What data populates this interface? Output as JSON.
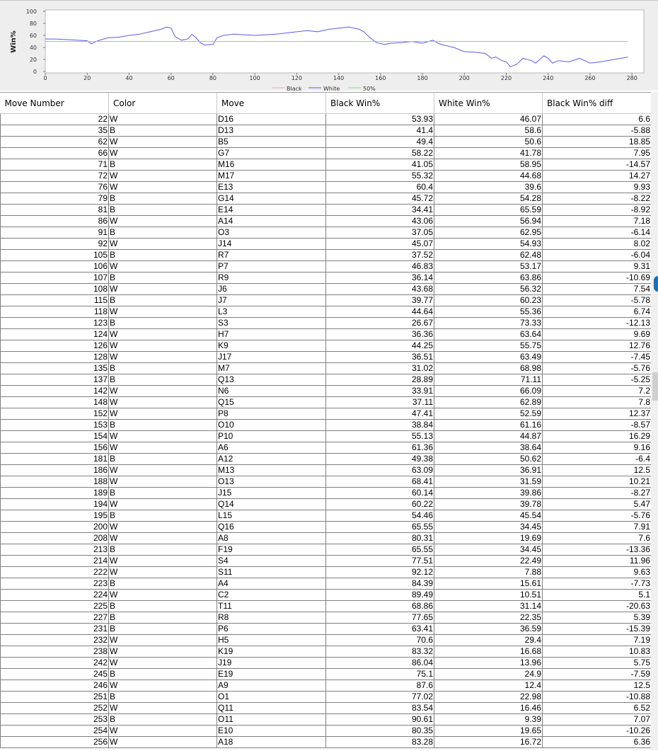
{
  "chart": {
    "ylabel": "Win%",
    "y_ticks": [
      "0",
      "20",
      "40",
      "60",
      "80",
      "100"
    ],
    "x_ticks": [
      "0",
      "20",
      "40",
      "60",
      "80",
      "100",
      "120",
      "140",
      "160",
      "180",
      "200",
      "220",
      "240",
      "260",
      "280"
    ],
    "legend": [
      "Black",
      "White",
      "50%"
    ],
    "colors": {
      "black": "#f4a6a6",
      "white": "#5b5bf0",
      "fifty": "#7ee07e"
    }
  },
  "chart_data": {
    "type": "line",
    "title": "",
    "xlabel": "",
    "ylabel": "Win%",
    "xlim": [
      0,
      285
    ],
    "ylim": [
      0,
      100
    ],
    "grid": false,
    "legend_position": "bottom",
    "series": [
      {
        "name": "White",
        "points": [
          [
            0,
            54
          ],
          [
            5,
            54
          ],
          [
            10,
            53
          ],
          [
            15,
            52
          ],
          [
            20,
            51
          ],
          [
            22,
            46
          ],
          [
            25,
            51
          ],
          [
            30,
            56
          ],
          [
            35,
            57
          ],
          [
            40,
            60
          ],
          [
            45,
            62
          ],
          [
            50,
            66
          ],
          [
            55,
            70
          ],
          [
            58,
            74
          ],
          [
            60,
            72
          ],
          [
            62,
            58
          ],
          [
            65,
            52
          ],
          [
            68,
            54
          ],
          [
            70,
            62
          ],
          [
            72,
            56
          ],
          [
            74,
            48
          ],
          [
            76,
            44
          ],
          [
            80,
            45
          ],
          [
            82,
            56
          ],
          [
            85,
            60
          ],
          [
            90,
            62
          ],
          [
            95,
            61
          ],
          [
            100,
            60
          ],
          [
            105,
            61
          ],
          [
            110,
            62
          ],
          [
            115,
            64
          ],
          [
            120,
            66
          ],
          [
            125,
            68
          ],
          [
            130,
            66
          ],
          [
            135,
            70
          ],
          [
            140,
            72
          ],
          [
            145,
            74
          ],
          [
            150,
            70
          ],
          [
            152,
            66
          ],
          [
            155,
            56
          ],
          [
            158,
            48
          ],
          [
            162,
            45
          ],
          [
            165,
            47
          ],
          [
            170,
            48
          ],
          [
            175,
            50
          ],
          [
            180,
            47
          ],
          [
            185,
            52
          ],
          [
            188,
            46
          ],
          [
            190,
            44
          ],
          [
            195,
            40
          ],
          [
            200,
            33
          ],
          [
            205,
            32
          ],
          [
            210,
            30
          ],
          [
            213,
            22
          ],
          [
            215,
            24
          ],
          [
            218,
            18
          ],
          [
            220,
            16
          ],
          [
            222,
            8
          ],
          [
            225,
            12
          ],
          [
            228,
            22
          ],
          [
            232,
            18
          ],
          [
            234,
            14
          ],
          [
            236,
            20
          ],
          [
            238,
            26
          ],
          [
            240,
            22
          ],
          [
            242,
            14
          ],
          [
            245,
            18
          ],
          [
            250,
            16
          ],
          [
            255,
            22
          ],
          [
            260,
            14
          ],
          [
            265,
            16
          ],
          [
            270,
            19
          ],
          [
            275,
            22
          ],
          [
            278,
            24
          ]
        ]
      },
      {
        "name": "50%",
        "points": [
          [
            0,
            50
          ],
          [
            278,
            50
          ]
        ]
      }
    ]
  },
  "table": {
    "columns": [
      "Move Number",
      "Color",
      "Move",
      "Black Win%",
      "White Win%",
      "Black Win% diff"
    ],
    "rows": [
      [
        "22",
        "W",
        "D16",
        "53.93",
        "46.07",
        "6.6"
      ],
      [
        "35",
        "B",
        "D13",
        "41.4",
        "58.6",
        "-5.88"
      ],
      [
        "62",
        "W",
        "B5",
        "49.4",
        "50.6",
        "18.85"
      ],
      [
        "66",
        "W",
        "G7",
        "58.22",
        "41.78",
        "7.95"
      ],
      [
        "71",
        "B",
        "M16",
        "41.05",
        "58.95",
        "-14.57"
      ],
      [
        "72",
        "W",
        "M17",
        "55.32",
        "44.68",
        "14.27"
      ],
      [
        "76",
        "W",
        "E13",
        "60.4",
        "39.6",
        "9.93"
      ],
      [
        "79",
        "B",
        "G14",
        "45.72",
        "54.28",
        "-8.22"
      ],
      [
        "81",
        "B",
        "E14",
        "34.41",
        "65.59",
        "-8.92"
      ],
      [
        "86",
        "W",
        "A14",
        "43.06",
        "56.94",
        "7.18"
      ],
      [
        "91",
        "B",
        "O3",
        "37.05",
        "62.95",
        "-6.14"
      ],
      [
        "92",
        "W",
        "J14",
        "45.07",
        "54.93",
        "8.02"
      ],
      [
        "105",
        "B",
        "R7",
        "37.52",
        "62.48",
        "-6.04"
      ],
      [
        "106",
        "W",
        "P7",
        "46.83",
        "53.17",
        "9.31"
      ],
      [
        "107",
        "B",
        "R9",
        "36.14",
        "63.86",
        "-10.69"
      ],
      [
        "108",
        "W",
        "J6",
        "43.68",
        "56.32",
        "7.54"
      ],
      [
        "115",
        "B",
        "J7",
        "39.77",
        "60.23",
        "-5.78"
      ],
      [
        "118",
        "W",
        "L3",
        "44.64",
        "55.36",
        "6.74"
      ],
      [
        "123",
        "B",
        "S3",
        "26.67",
        "73.33",
        "-12.13"
      ],
      [
        "124",
        "W",
        "H7",
        "36.36",
        "63.64",
        "9.69"
      ],
      [
        "126",
        "W",
        "K9",
        "44.25",
        "55.75",
        "12.76"
      ],
      [
        "128",
        "W",
        "J17",
        "36.51",
        "63.49",
        "-7.45"
      ],
      [
        "135",
        "B",
        "M7",
        "31.02",
        "68.98",
        "-5.76"
      ],
      [
        "137",
        "B",
        "Q13",
        "28.89",
        "71.11",
        "-5.25"
      ],
      [
        "142",
        "W",
        "N6",
        "33.91",
        "66.09",
        "7.2"
      ],
      [
        "148",
        "W",
        "Q15",
        "37.11",
        "62.89",
        "7.8"
      ],
      [
        "152",
        "W",
        "P8",
        "47.41",
        "52.59",
        "12.37"
      ],
      [
        "153",
        "B",
        "O10",
        "38.84",
        "61.16",
        "-8.57"
      ],
      [
        "154",
        "W",
        "P10",
        "55.13",
        "44.87",
        "16.29"
      ],
      [
        "156",
        "W",
        "A6",
        "61.36",
        "38.64",
        "9.16"
      ],
      [
        "181",
        "B",
        "A12",
        "49.38",
        "50.62",
        "-6.4"
      ],
      [
        "186",
        "W",
        "M13",
        "63.09",
        "36.91",
        "12.5"
      ],
      [
        "188",
        "W",
        "O13",
        "68.41",
        "31.59",
        "10.21"
      ],
      [
        "189",
        "B",
        "J15",
        "60.14",
        "39.86",
        "-8.27"
      ],
      [
        "194",
        "W",
        "Q14",
        "60.22",
        "39.78",
        "5.47"
      ],
      [
        "195",
        "B",
        "L15",
        "54.46",
        "45.54",
        "-5.76"
      ],
      [
        "200",
        "W",
        "Q16",
        "65.55",
        "34.45",
        "7.91"
      ],
      [
        "208",
        "W",
        "A8",
        "80.31",
        "19.69",
        "7.6"
      ],
      [
        "213",
        "B",
        "F19",
        "65.55",
        "34.45",
        "-13.36"
      ],
      [
        "214",
        "W",
        "S4",
        "77.51",
        "22.49",
        "11.96"
      ],
      [
        "222",
        "W",
        "S11",
        "92.12",
        "7.88",
        "9.63"
      ],
      [
        "223",
        "B",
        "A4",
        "84.39",
        "15.61",
        "-7.73"
      ],
      [
        "224",
        "W",
        "C2",
        "89.49",
        "10.51",
        "5.1"
      ],
      [
        "225",
        "B",
        "T11",
        "68.86",
        "31.14",
        "-20.63"
      ],
      [
        "227",
        "B",
        "R8",
        "77.65",
        "22.35",
        "5.39"
      ],
      [
        "231",
        "B",
        "P6",
        "63.41",
        "36.59",
        "-15.39"
      ],
      [
        "232",
        "W",
        "H5",
        "70.6",
        "29.4",
        "7.19"
      ],
      [
        "238",
        "W",
        "K19",
        "83.32",
        "16.68",
        "10.83"
      ],
      [
        "242",
        "W",
        "J19",
        "86.04",
        "13.96",
        "5.75"
      ],
      [
        "245",
        "B",
        "E19",
        "75.1",
        "24.9",
        "-7.59"
      ],
      [
        "246",
        "W",
        "A9",
        "87.6",
        "12.4",
        "12.5"
      ],
      [
        "251",
        "B",
        "O1",
        "77.02",
        "22.98",
        "-10.88"
      ],
      [
        "252",
        "W",
        "Q11",
        "83.54",
        "16.46",
        "6.52"
      ],
      [
        "253",
        "B",
        "O11",
        "90.61",
        "9.39",
        "7.07"
      ],
      [
        "254",
        "W",
        "E10",
        "80.35",
        "19.65",
        "-10.26"
      ],
      [
        "256",
        "W",
        "A18",
        "83.28",
        "16.72",
        "6.36"
      ]
    ]
  }
}
